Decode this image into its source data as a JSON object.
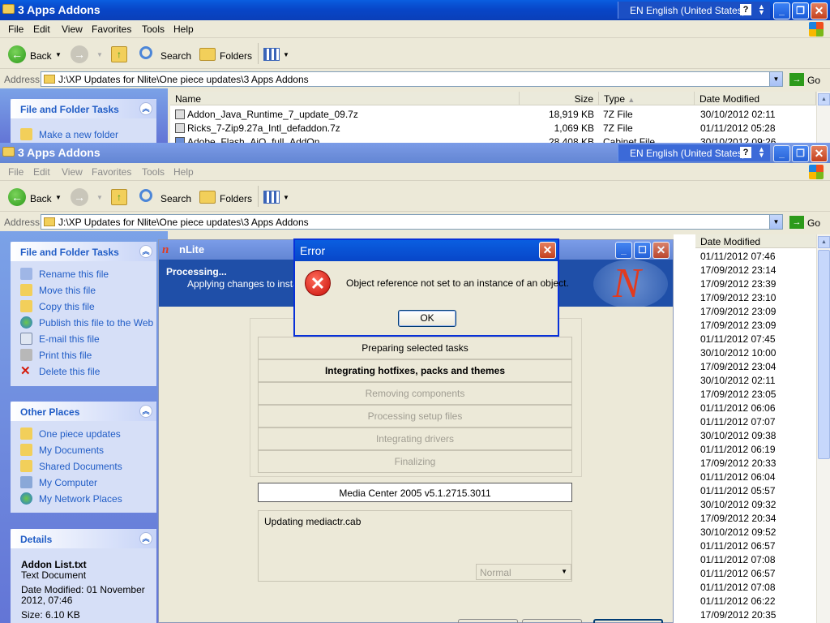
{
  "back_window": {
    "title": "3 Apps Addons",
    "language": "EN English (United States)",
    "menu": [
      "File",
      "Edit",
      "View",
      "Favorites",
      "Tools",
      "Help"
    ],
    "toolbar": {
      "back": "Back",
      "search": "Search",
      "folders": "Folders"
    },
    "address": {
      "label": "Address",
      "path": "J:\\XP Updates for Nlite\\One piece updates\\3 Apps Addons",
      "go": "Go"
    },
    "tasks_panel": {
      "title": "File and Folder Tasks",
      "item": "Make a new folder"
    },
    "columns": {
      "name": "Name",
      "size": "Size",
      "type": "Type",
      "date": "Date Modified"
    },
    "files": [
      {
        "name": "Addon_Java_Runtime_7_update_09.7z",
        "size": "18,919 KB",
        "type": "7Z File",
        "date": "30/10/2012 02:11"
      },
      {
        "name": "Ricks_7-Zip9.27a_Intl_defaddon.7z",
        "size": "1,069 KB",
        "type": "7Z File",
        "date": "01/11/2012 05:28"
      },
      {
        "name": "Adobe_Flash_AiO_full_AddOn",
        "size": "28,408 KB",
        "type": "Cabinet File",
        "date": "30/10/2012 09:26"
      }
    ]
  },
  "front_window": {
    "title": "3 Apps Addons",
    "language": "EN English (United States)",
    "menu": [
      "File",
      "Edit",
      "View",
      "Favorites",
      "Tools",
      "Help"
    ],
    "toolbar": {
      "back": "Back",
      "search": "Search",
      "folders": "Folders"
    },
    "address": {
      "label": "Address",
      "path": "J:\\XP Updates for Nlite\\One piece updates\\3 Apps Addons",
      "go": "Go"
    },
    "tasks_panel": {
      "title": "File and Folder Tasks",
      "items": [
        "Rename this file",
        "Move this file",
        "Copy this file",
        "Publish this file to the Web",
        "E-mail this file",
        "Print this file",
        "Delete this file"
      ]
    },
    "other_places": {
      "title": "Other Places",
      "items": [
        "One piece updates",
        "My Documents",
        "Shared Documents",
        "My Computer",
        "My Network Places"
      ]
    },
    "details": {
      "title": "Details",
      "file_name": "Addon List.txt",
      "file_type": "Text Document",
      "modified_line1": "Date Modified: 01 November",
      "modified_line2": "2012, 07:46",
      "size": "Size: 6.10 KB"
    },
    "date_column_header": "Date Modified",
    "dates": [
      "01/11/2012 07:46",
      "17/09/2012 23:14",
      "17/09/2012 23:39",
      "17/09/2012 23:10",
      "17/09/2012 23:09",
      "17/09/2012 23:09",
      "01/11/2012 07:45",
      "30/10/2012 10:00",
      "17/09/2012 23:04",
      "30/10/2012 02:11",
      "17/09/2012 23:05",
      "01/11/2012 06:06",
      "01/11/2012 07:07",
      "30/10/2012 09:38",
      "01/11/2012 06:19",
      "17/09/2012 20:33",
      "01/11/2012 06:04",
      "01/11/2012 05:57",
      "30/10/2012 09:32",
      "17/09/2012 20:34",
      "30/10/2012 09:52",
      "01/11/2012 06:57",
      "01/11/2012 07:08",
      "01/11/2012 06:57",
      "01/11/2012 07:08",
      "01/11/2012 06:22",
      "17/09/2012 20:35"
    ]
  },
  "nlite": {
    "title": "nLite",
    "heading": "Processing...",
    "subheading": "Applying changes to installa",
    "stages": [
      {
        "label": "Preparing selected tasks",
        "state": "done"
      },
      {
        "label": "Integrating hotfixes, packs and themes",
        "state": "active"
      },
      {
        "label": "Removing components",
        "state": "pending"
      },
      {
        "label": "Processing setup files",
        "state": "pending"
      },
      {
        "label": "Integrating drivers",
        "state": "pending"
      },
      {
        "label": "Finalizing",
        "state": "pending"
      }
    ],
    "current_item": "Media Center 2005 v5.1.2715.3011",
    "log_text": "Updating mediactr.cab",
    "priority_value": "Normal"
  },
  "error_dialog": {
    "title": "Error",
    "message": "Object reference not set to an instance of an object.",
    "ok_label": "OK",
    "icon": "error-x-icon"
  }
}
